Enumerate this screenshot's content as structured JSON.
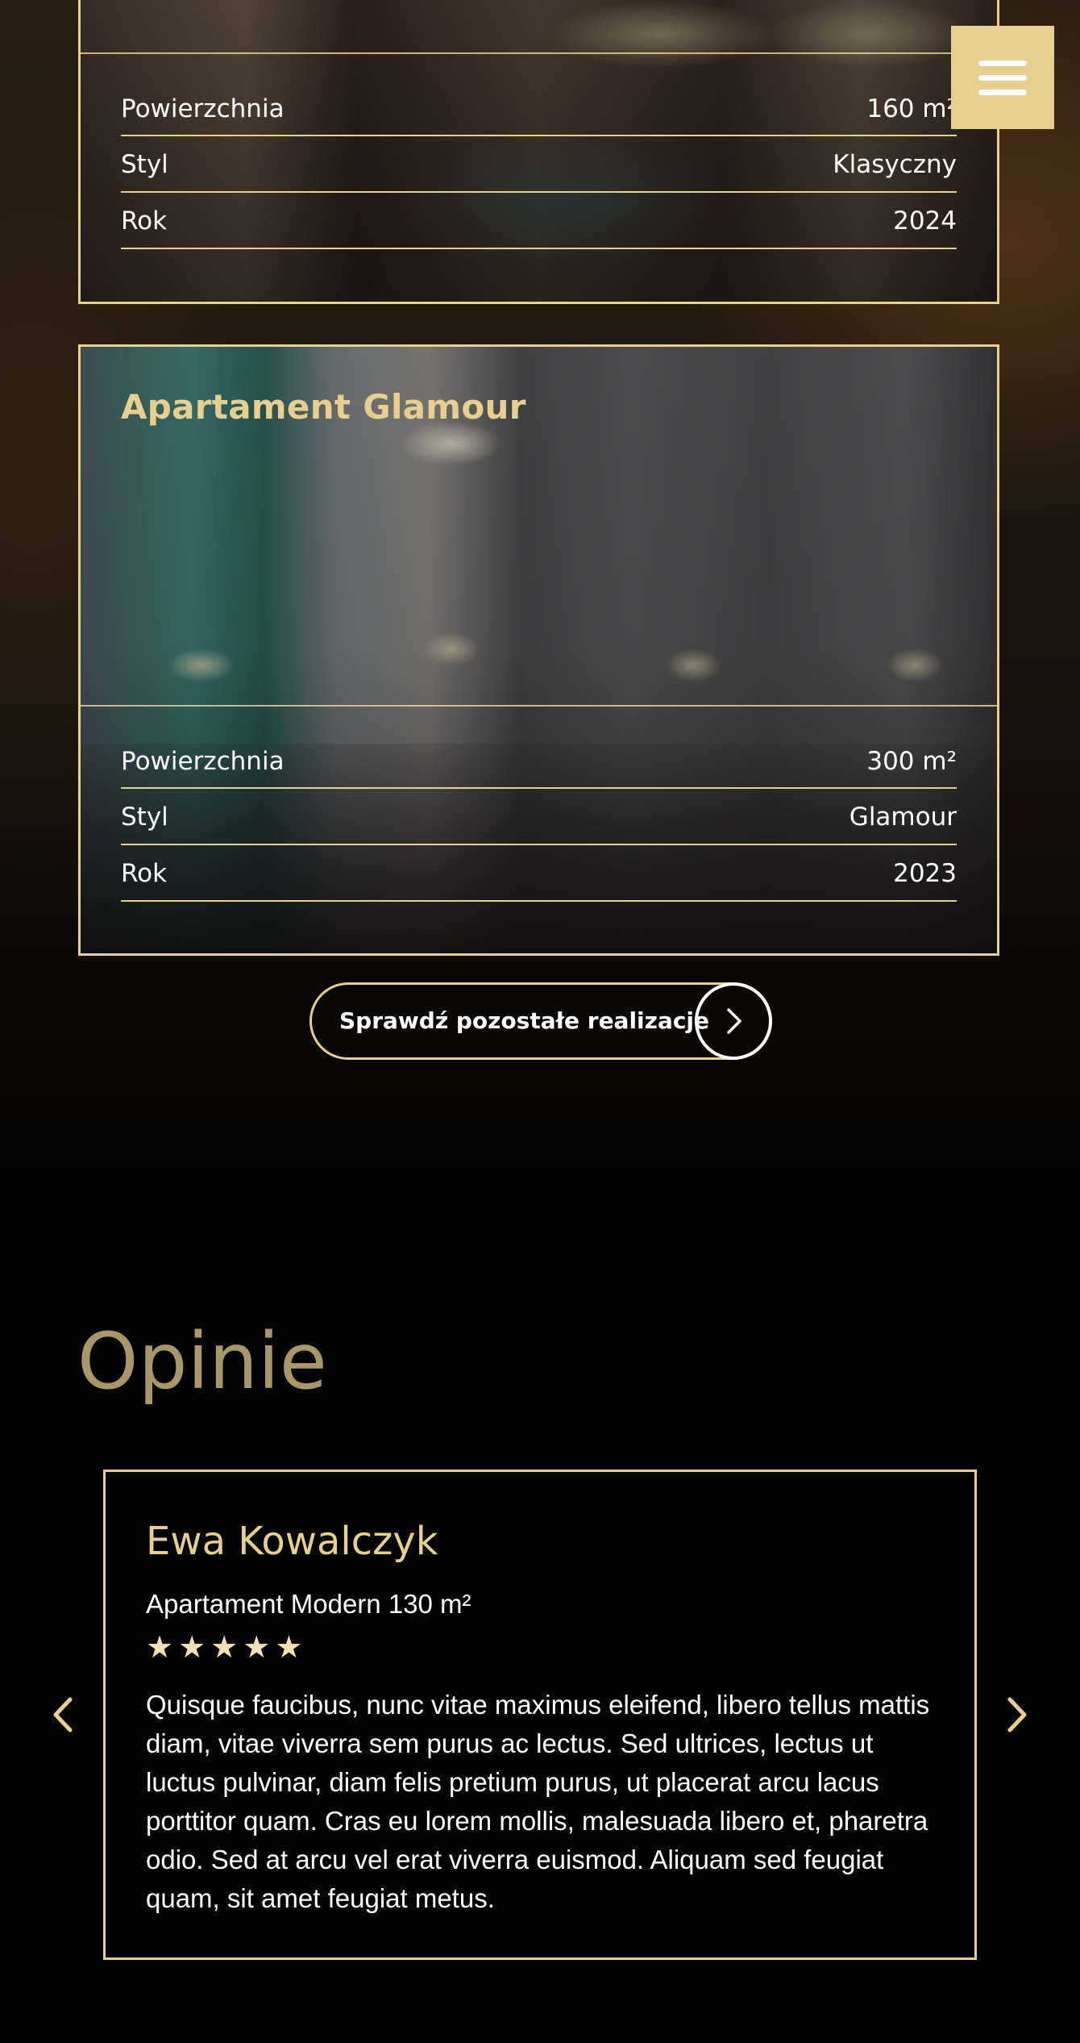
{
  "projects": [
    {
      "title": "",
      "specs": [
        {
          "label": "Powierzchnia",
          "value": "160 m²"
        },
        {
          "label": "Styl",
          "value": "Klasyczny"
        },
        {
          "label": "Rok",
          "value": "2024"
        }
      ]
    },
    {
      "title": "Apartament Glamour",
      "specs": [
        {
          "label": "Powierzchnia",
          "value": "300 m²"
        },
        {
          "label": "Styl",
          "value": "Glamour"
        },
        {
          "label": "Rok",
          "value": "2023"
        }
      ]
    }
  ],
  "menu": {
    "icon": "hamburger-menu-icon"
  },
  "cta": {
    "label": "Sprawdź pozostałe realizacje",
    "icon": "chevron-right-icon"
  },
  "opinions": {
    "title": "Opinie",
    "review": {
      "name": "Ewa Kowalczyk",
      "project": "Apartament Modern 130 m²",
      "rating": 5,
      "star_glyph": "★",
      "text": "Quisque faucibus, nunc vitae maximus eleifend, libero tellus mattis diam, vitae viverra sem purus ac lectus. Sed ultrices, lectus ut luctus pulvinar, diam felis pretium purus, ut placerat arcu lacus porttitor quam. Cras eu lorem mollis, malesuada libero et, pharetra odio. Sed at arcu vel erat viverra euismod. Aliquam sed feugiat quam, sit amet feugiat metus."
    },
    "prev_icon": "chevron-left-icon",
    "next_icon": "chevron-right-icon"
  },
  "colors": {
    "accent": "#e6cf8f",
    "section_title": "#a9976a",
    "star": "#f1e1b6",
    "background": "#030303",
    "text": "#ffffff"
  }
}
